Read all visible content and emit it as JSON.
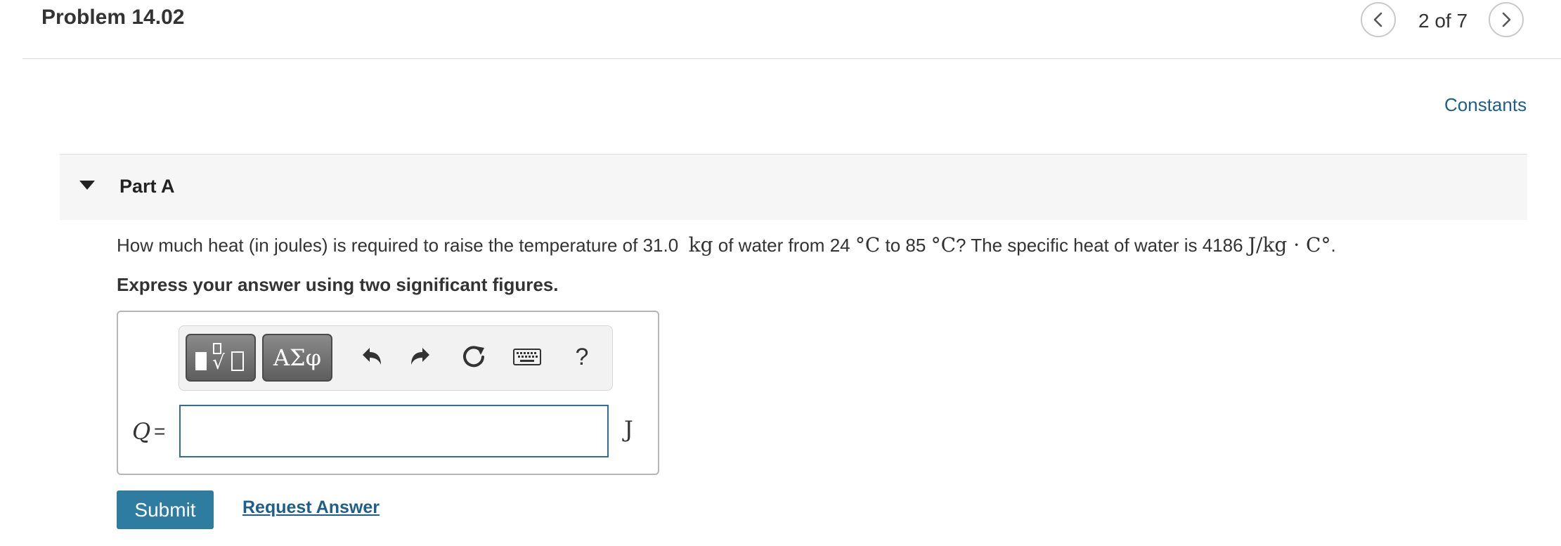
{
  "header": {
    "title": "Problem 14.02",
    "counter": "2 of 7",
    "prev_icon": "chevron-left-icon",
    "next_icon": "chevron-right-icon"
  },
  "links": {
    "constants": "Constants"
  },
  "part": {
    "title": "Part A",
    "caret_icon": "caret-down-icon"
  },
  "question": {
    "t1": "How much heat (in joules) is required to raise the temperature of 31.0",
    "m1": "kg",
    "t2": " of water from 24",
    "m2": "°C",
    "t3": " to 85",
    "m3": "°C",
    "t4": "? The specific heat of water is 4186",
    "m4": "J/kg · C°",
    "t5": "."
  },
  "instruction": "Express your answer using two significant figures.",
  "toolbar": {
    "templates_icon": "templates-icon",
    "greek_label": "ΑΣφ",
    "undo_icon": "undo-icon",
    "redo_icon": "redo-icon",
    "reset_icon": "reset-icon",
    "keyboard_icon": "keyboard-icon",
    "help_label": "?"
  },
  "answer": {
    "variable": "Q",
    "equals": "=",
    "value": "",
    "unit": "J"
  },
  "actions": {
    "submit_label": "Submit",
    "request_label": "Request Answer"
  },
  "colors": {
    "link": "#1d5f8a",
    "submit_bg": "#2e7da1",
    "input_border": "#2d6f96",
    "part_bar_bg": "#f6f6f6"
  }
}
